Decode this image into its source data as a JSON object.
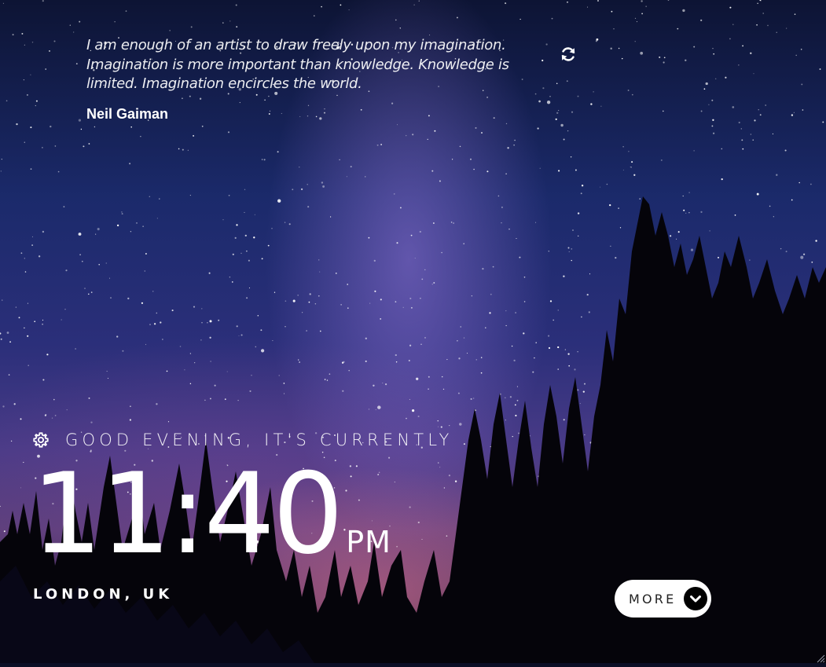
{
  "quote": {
    "text": "I am enough of an artist to draw freely upon my imagination. Imagination is more important than knowledge. Knowledge is limited. Imagination encircles the world.",
    "author": "Neil Gaiman",
    "refresh_icon": "refresh-icon"
  },
  "greeting": {
    "settings_icon": "gear-icon",
    "text": "GOOD EVENING, IT'S CURRENTLY"
  },
  "clock": {
    "time": "11:40",
    "period": "PM"
  },
  "location": {
    "text": "LONDON, UK"
  },
  "more_button": {
    "label": "MORE",
    "icon": "chevron-down-icon"
  },
  "colors": {
    "text": "#ffffff",
    "button_bg": "#ffffff",
    "button_text": "#222222",
    "chevron_bg": "#000000"
  }
}
